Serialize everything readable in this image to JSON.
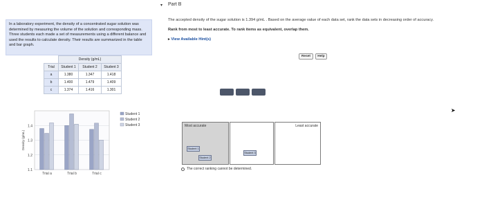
{
  "prompt": {
    "text": "In a laboratory experiment, the density of a concentrated sugar solution was determined by measuring the volume of the solution and corresponding mass. Three students each made a set of measurements using a different balance and used the results to calculate density. Their results are summarized in the table and bar graph."
  },
  "table": {
    "density_header": "Density (g/mL)",
    "trial_header": "Trial",
    "student_headers": [
      "Student 1",
      "Student 2",
      "Student 3"
    ],
    "rows": [
      {
        "trial": "a",
        "values": [
          "1.380",
          "1.347",
          "1.418"
        ]
      },
      {
        "trial": "b",
        "values": [
          "1.400",
          "1.479",
          "1.409"
        ]
      },
      {
        "trial": "c",
        "values": [
          "1.374",
          "1.416",
          "1.301"
        ]
      }
    ]
  },
  "chart_data": {
    "type": "bar",
    "categories": [
      "Trial a",
      "Trial b",
      "Trial c"
    ],
    "series": [
      {
        "name": "Student 1",
        "values": [
          1.38,
          1.4,
          1.374
        ]
      },
      {
        "name": "Student 2",
        "values": [
          1.347,
          1.479,
          1.416
        ]
      },
      {
        "name": "Student 3",
        "values": [
          1.418,
          1.409,
          1.301
        ]
      }
    ],
    "ylabel": "Density (g/mL)",
    "yticks": [
      "1.1",
      "1.2",
      "1.3",
      "1.4"
    ],
    "ylim": [
      1.1,
      1.5
    ],
    "legend": "right",
    "colors": [
      "#9aa5c6",
      "#b5bdd4",
      "#cfd5e4"
    ]
  },
  "part": {
    "label": "Part B"
  },
  "question": {
    "text": "The accepted density of the sugar solution is 1.394 g/mL . Based on the average value of each data set, rank the data sets in decreasing order of accuracy.",
    "ranking": "Rank from most to least accurate. To rank items as equivalent, overlap them.",
    "hints": "View Available Hint(s)"
  },
  "buttons": {
    "reset": "Reset",
    "help": "Help"
  },
  "zones": {
    "most": "Most accurate",
    "least": "Least accurate"
  },
  "cards": {
    "s1": "Student 1",
    "s2": "Student 2",
    "s3": "Student 3"
  },
  "option": {
    "label": "The correct ranking cannot be determined."
  }
}
